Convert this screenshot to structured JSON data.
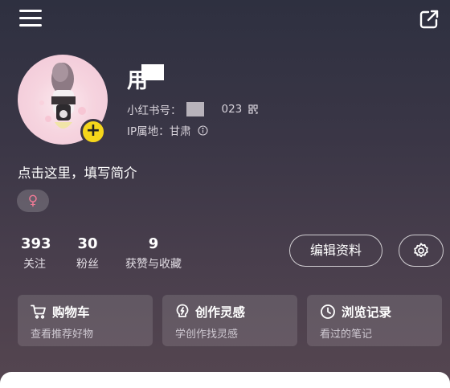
{
  "header": {
    "menu_icon": "hamburger-menu-icon",
    "share_icon": "share-external-icon"
  },
  "profile": {
    "nickname": "用",
    "id_label": "小红书号：",
    "id_suffix": "023",
    "ip_label": "IP属地：",
    "ip_value": "甘肃",
    "bio_placeholder": "点击这里，填写简介",
    "gender_symbol": "♀",
    "add_symbol": "+"
  },
  "stats": [
    {
      "value": "393",
      "label": "关注"
    },
    {
      "value": "30",
      "label": "粉丝"
    },
    {
      "value": "9",
      "label": "获赞与收藏"
    }
  ],
  "actions": {
    "edit_profile": "编辑资料",
    "settings_icon": "gear-icon"
  },
  "cards": [
    {
      "title": "购物车",
      "subtitle": "查看推荐好物",
      "icon": "shopping-cart-icon"
    },
    {
      "title": "创作灵感",
      "subtitle": "学创作找灵感",
      "icon": "lightbulb-icon"
    },
    {
      "title": "浏览记录",
      "subtitle": "看过的笔记",
      "icon": "clock-history-icon"
    }
  ],
  "colors": {
    "accent_yellow": "#f5d61b",
    "gender_pink": "#f07a95"
  }
}
